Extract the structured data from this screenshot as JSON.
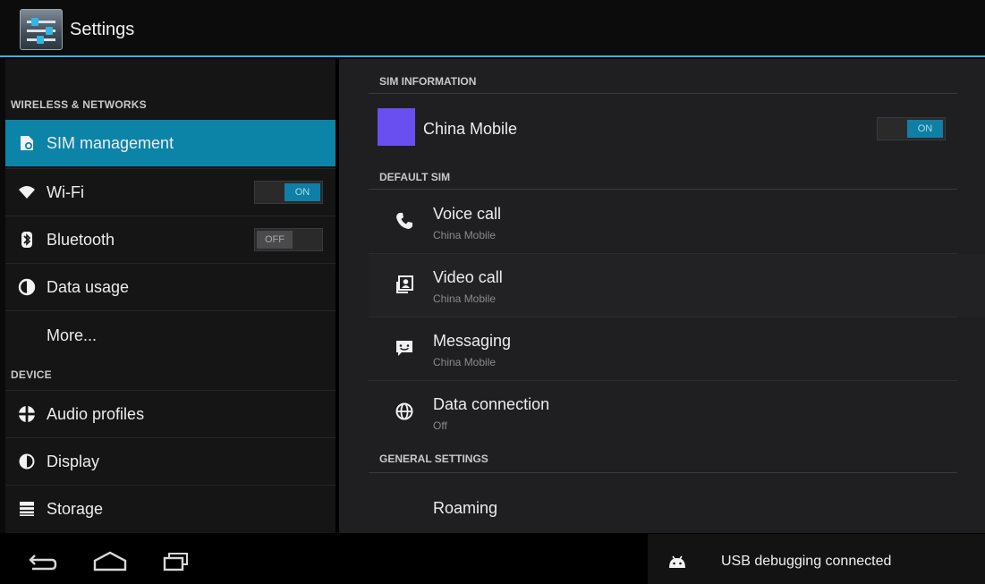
{
  "action_bar": {
    "title": "Settings"
  },
  "left_pane": {
    "sections": [
      {
        "header": "WIRELESS & NETWORKS"
      },
      {
        "header": "DEVICE"
      }
    ],
    "items": [
      {
        "label": "SIM management",
        "icon": "sim-card-icon",
        "selected": true
      },
      {
        "label": "Wi-Fi",
        "icon": "wifi-icon",
        "toggle": "ON"
      },
      {
        "label": "Bluetooth",
        "icon": "bluetooth-icon",
        "toggle": "OFF"
      },
      {
        "label": "Data usage",
        "icon": "data-usage-icon"
      },
      {
        "label": "More...",
        "icon": null
      },
      {
        "label": "Audio profiles",
        "icon": "audio-profiles-icon"
      },
      {
        "label": "Display",
        "icon": "display-icon"
      },
      {
        "label": "Storage",
        "icon": "storage-icon"
      }
    ]
  },
  "right_pane": {
    "sim_information": {
      "header": "SIM INFORMATION",
      "sim_name": "China Mobile",
      "toggle": "ON",
      "sim_color": "#6a4ff0"
    },
    "default_sim": {
      "header": "DEFAULT SIM",
      "items": [
        {
          "title": "Voice call",
          "subtitle": "China Mobile",
          "icon": "phone-icon"
        },
        {
          "title": "Video call",
          "subtitle": "China Mobile",
          "icon": "video-call-icon"
        },
        {
          "title": "Messaging",
          "subtitle": "China Mobile",
          "icon": "messaging-icon"
        },
        {
          "title": "Data connection",
          "subtitle": "Off",
          "icon": "globe-icon"
        }
      ]
    },
    "general_settings": {
      "header": "GENERAL SETTINGS",
      "items": [
        {
          "title": "Roaming"
        }
      ]
    }
  },
  "nav_bar": {
    "buttons": [
      "back-icon",
      "home-icon",
      "recent-apps-icon"
    ]
  },
  "status": {
    "text": "USB debugging connected",
    "icon": "android-debug-icon"
  },
  "colors": {
    "accent": "#33b5e5",
    "selected": "#0c84a8",
    "toggle_on": "#0f7fa6"
  }
}
